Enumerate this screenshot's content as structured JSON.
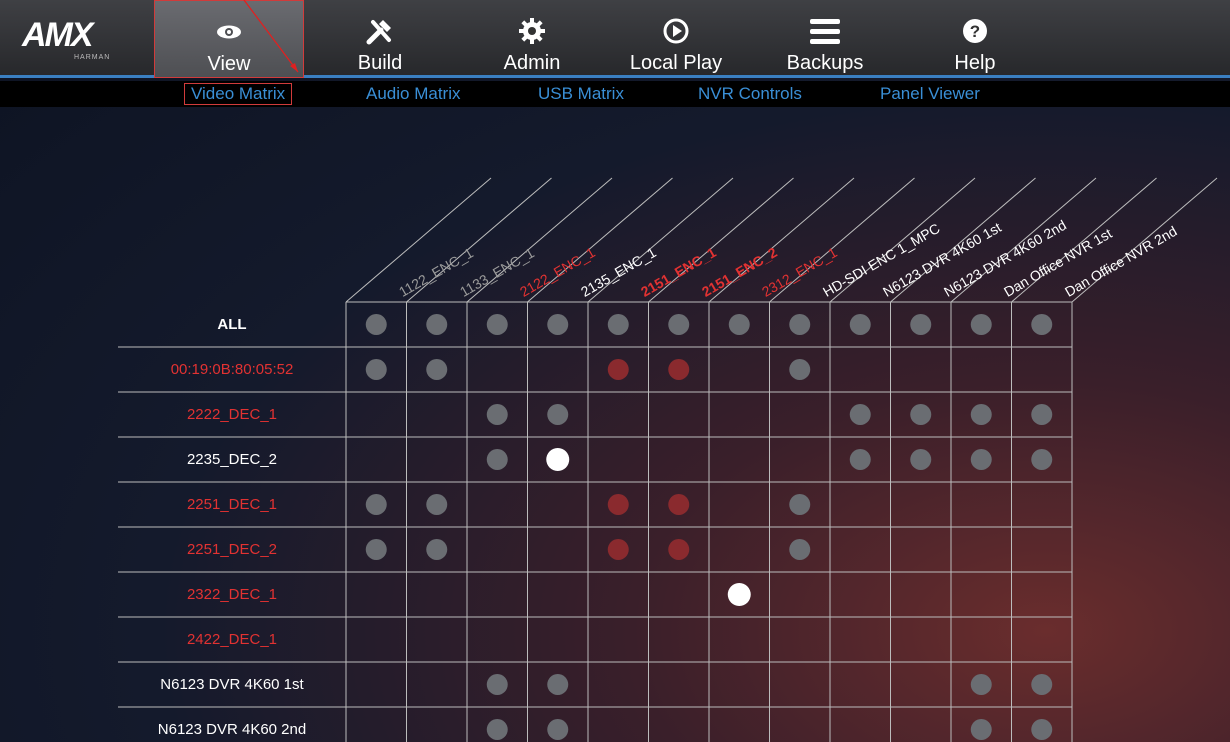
{
  "colors": {
    "accent": "#3a7fc1",
    "red": "#e23232",
    "dot_grey": "#6a6d72",
    "dot_red": "#8a2a2e",
    "dot_white": "#ffffff",
    "grid": "#bcbcbc"
  },
  "brand": {
    "logo": "AMX",
    "sub": "HARMAN"
  },
  "nav": [
    {
      "label": "View",
      "icon": "eye-icon",
      "active": true
    },
    {
      "label": "Build",
      "icon": "tools-icon",
      "active": false
    },
    {
      "label": "Admin",
      "icon": "gear-icon",
      "active": false
    },
    {
      "label": "Local Play",
      "icon": "play-icon",
      "active": false
    },
    {
      "label": "Backups",
      "icon": "menu-icon",
      "active": false
    },
    {
      "label": "Help",
      "icon": "help-icon",
      "active": false
    }
  ],
  "subnav": [
    {
      "label": "Video Matrix",
      "active": true
    },
    {
      "label": "Audio Matrix",
      "active": false
    },
    {
      "label": "USB Matrix",
      "active": false
    },
    {
      "label": "NVR Controls",
      "active": false
    },
    {
      "label": "Panel Viewer",
      "active": false
    }
  ],
  "matrix": {
    "columns": [
      {
        "label": "1122_ENC_1",
        "color": "grey",
        "bold": false
      },
      {
        "label": "1133_ENC_1",
        "color": "grey",
        "bold": false
      },
      {
        "label": "2122_ENC_1",
        "color": "red",
        "bold": false
      },
      {
        "label": "2135_ENC_1",
        "color": "white",
        "bold": false
      },
      {
        "label": "2151_ENC_1",
        "color": "red",
        "bold": true
      },
      {
        "label": "2151_ENC_2",
        "color": "red",
        "bold": true
      },
      {
        "label": "2312_ENC_1",
        "color": "red",
        "bold": false
      },
      {
        "label": "HD-SDI ENC 1_MPC",
        "color": "white",
        "bold": false
      },
      {
        "label": "N6123 DVR 4K60 1st",
        "color": "white",
        "bold": false
      },
      {
        "label": "N6123 DVR 4K60 2nd",
        "color": "white",
        "bold": false
      },
      {
        "label": "Dan Office NVR 1st",
        "color": "white",
        "bold": false
      },
      {
        "label": "Dan Office NVR 2nd",
        "color": "white",
        "bold": false
      }
    ],
    "rows": [
      {
        "label": "ALL",
        "color": "white",
        "cells": "GGGGGGGGGGGG"
      },
      {
        "label": "00:19:0B:80:05:52",
        "color": "red",
        "cells": "GG..RR.G...."
      },
      {
        "label": "2222_DEC_1",
        "color": "red",
        "cells": "..GG....GGGG"
      },
      {
        "label": "2235_DEC_2",
        "color": "white",
        "cells": "..GW....GGGG"
      },
      {
        "label": "2251_DEC_1",
        "color": "red",
        "cells": "GG..RR.G...."
      },
      {
        "label": "2251_DEC_2",
        "color": "red",
        "cells": "GG..RR.G...."
      },
      {
        "label": "2322_DEC_1",
        "color": "red",
        "cells": "......W....."
      },
      {
        "label": "2422_DEC_1",
        "color": "red",
        "cells": "............"
      },
      {
        "label": "N6123 DVR 4K60 1st",
        "color": "white",
        "cells": "..GG......GG"
      },
      {
        "label": "N6123 DVR 4K60 2nd",
        "color": "white",
        "cells": "..GG......GG"
      }
    ]
  }
}
